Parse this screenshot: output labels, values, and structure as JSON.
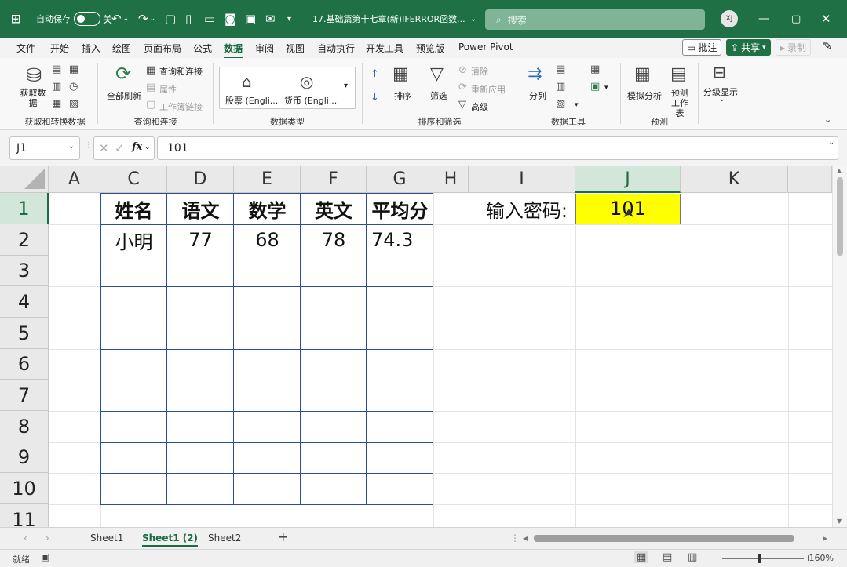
{
  "titlebar": {
    "app_icon": "excel-icon",
    "autosave_label": "自动保存",
    "autosave_state": "关",
    "doc_title": "17.基础篇第十七章(新)IFERROR函数...",
    "search_placeholder": "搜索",
    "avatar": "XJ"
  },
  "menu": {
    "tabs": [
      "文件",
      "开始",
      "插入",
      "绘图",
      "页面布局",
      "公式",
      "数据",
      "审阅",
      "视图",
      "自动执行",
      "开发工具",
      "预览版",
      "Power Pivot"
    ],
    "active": "数据",
    "comment_btn": "批注",
    "share_btn": "共享",
    "record_btn": "录制"
  },
  "ribbon": {
    "get_data": "获取数据",
    "refresh_all": "全部刷新",
    "queries": "查询和连接",
    "properties": "属性",
    "edit_links": "工作簿链接",
    "stocks": "股票 (Engli...",
    "currency": "货币 (Engli...",
    "sort": "排序",
    "filter": "筛选",
    "clear": "清除",
    "reapply": "重新应用",
    "advanced": "高级",
    "text_to_columns": "分列",
    "what_if": "模拟分析",
    "forecast_sheet": "预测工作表",
    "outline": "分级显示",
    "groups": [
      "获取和转换数据",
      "查询和连接",
      "数据类型",
      "排序和筛选",
      "数据工具",
      "预测"
    ]
  },
  "formula_bar": {
    "name_box": "J1",
    "fx": "fx",
    "value": "101"
  },
  "grid": {
    "columns": [
      "A",
      "C",
      "D",
      "E",
      "F",
      "G",
      "H",
      "I",
      "J",
      "K"
    ],
    "rows": [
      "1",
      "2",
      "3",
      "4",
      "5",
      "6",
      "7",
      "8",
      "9",
      "10",
      "11"
    ],
    "table_headers": [
      "姓名",
      "语文",
      "数学",
      "英文",
      "平均分"
    ],
    "table_row": [
      "小明",
      "77",
      "68",
      "78",
      "74.3"
    ],
    "password_label": "输入密码:",
    "password_value": "101"
  },
  "sheets": {
    "tabs": [
      "Sheet1",
      "Sheet1 (2)",
      "Sheet2"
    ],
    "active": "Sheet1 (2)",
    "add": "+"
  },
  "status": {
    "ready": "就绪",
    "zoom": "160%"
  }
}
